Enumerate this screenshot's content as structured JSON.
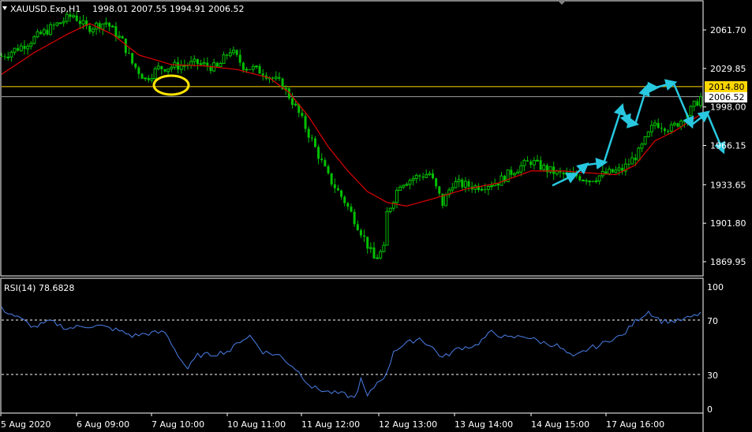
{
  "header": {
    "symbol": "XAUUSD.Exp,H1",
    "ohlc": "1998.01 2007.55 1994.91 2006.52"
  },
  "colors": {
    "background": "#000000",
    "frame": "#ffffff",
    "bull": "#00c000",
    "bear": "#00c000",
    "ma": "#e00000",
    "level_line": "#ffd700",
    "price_line": "#a0a0a0",
    "arrows": "#28c8e0",
    "rsi_line": "#4a7fe8",
    "highlight_circle": "#ffe600"
  },
  "price_axis": {
    "ticks": [
      "2061.70",
      "2029.85",
      "1998.00",
      "1966.15",
      "1933.65",
      "1901.80",
      "1869.95"
    ],
    "level_label": "2014.80",
    "last_price_label": "2006.52"
  },
  "rsi_panel": {
    "label": "RSI(14) 78.6828",
    "ticks": [
      "100",
      "70",
      "30",
      "0"
    ]
  },
  "time_axis": {
    "labels": [
      "5 Aug 2020",
      "6 Aug 09:00",
      "7 Aug 10:00",
      "10 Aug 11:00",
      "11 Aug 12:00",
      "12 Aug 13:00",
      "13 Aug 14:00",
      "14 Aug 15:00",
      "17 Aug 16:00"
    ]
  },
  "chart_data": {
    "type": "candlestick",
    "symbol": "XAUUSD.Exp",
    "timeframe": "H1",
    "ylim": [
      1855,
      2080
    ],
    "level_line": 2014.8,
    "last_price": 2006.52,
    "rsi_value": 78.6828,
    "rsi_ylim": [
      0,
      100
    ],
    "rsi_levels": [
      70,
      30
    ],
    "x_labels": [
      "5 Aug 2020",
      "6 Aug 09:00",
      "7 Aug 10:00",
      "10 Aug 11:00",
      "11 Aug 12:00",
      "12 Aug 13:00",
      "13 Aug 14:00",
      "14 Aug 15:00",
      "17 Aug 16:00"
    ],
    "price_path": [
      [
        0,
        2040
      ],
      [
        6,
        2048
      ],
      [
        12,
        2058
      ],
      [
        18,
        2068
      ],
      [
        22,
        2074
      ],
      [
        26,
        2063
      ],
      [
        32,
        2068
      ],
      [
        37,
        2052
      ],
      [
        40,
        2034
      ],
      [
        44,
        2021
      ],
      [
        48,
        2030
      ],
      [
        54,
        2032
      ],
      [
        60,
        2034
      ],
      [
        66,
        2030
      ],
      [
        70,
        2045
      ],
      [
        74,
        2032
      ],
      [
        80,
        2027
      ],
      [
        86,
        2016
      ],
      [
        90,
        1998
      ],
      [
        95,
        1970
      ],
      [
        100,
        1940
      ],
      [
        105,
        1920
      ],
      [
        110,
        1895
      ],
      [
        114,
        1872
      ],
      [
        117,
        1880
      ],
      [
        118,
        1910
      ],
      [
        122,
        1935
      ],
      [
        127,
        1940
      ],
      [
        131,
        1943
      ],
      [
        135,
        1918
      ],
      [
        138,
        1935
      ],
      [
        145,
        1932
      ],
      [
        152,
        1936
      ],
      [
        157,
        1946
      ],
      [
        162,
        1953
      ],
      [
        167,
        1946
      ],
      [
        171,
        1942
      ],
      [
        176,
        1941
      ],
      [
        180,
        1938
      ],
      [
        184,
        1942
      ],
      [
        190,
        1946
      ],
      [
        195,
        1960
      ],
      [
        200,
        1985
      ],
      [
        205,
        1980
      ],
      [
        210,
        1992
      ],
      [
        214,
        2006
      ]
    ],
    "ma_path": [
      [
        0,
        2025
      ],
      [
        10,
        2043
      ],
      [
        20,
        2058
      ],
      [
        27,
        2067
      ],
      [
        34,
        2058
      ],
      [
        42,
        2041
      ],
      [
        52,
        2033
      ],
      [
        62,
        2032
      ],
      [
        72,
        2029
      ],
      [
        82,
        2022
      ],
      [
        88,
        2010
      ],
      [
        94,
        1990
      ],
      [
        100,
        1965
      ],
      [
        106,
        1945
      ],
      [
        112,
        1928
      ],
      [
        118,
        1919
      ],
      [
        124,
        1916
      ],
      [
        132,
        1922
      ],
      [
        142,
        1930
      ],
      [
        152,
        1935
      ],
      [
        162,
        1945
      ],
      [
        172,
        1945
      ],
      [
        182,
        1943
      ],
      [
        188,
        1942
      ],
      [
        194,
        1950
      ],
      [
        200,
        1970
      ],
      [
        206,
        1978
      ],
      [
        214,
        1992
      ]
    ],
    "rsi_path": [
      [
        0,
        82
      ],
      [
        5,
        75
      ],
      [
        10,
        67
      ],
      [
        15,
        72
      ],
      [
        20,
        66
      ],
      [
        25,
        68
      ],
      [
        30,
        68
      ],
      [
        35,
        65
      ],
      [
        40,
        60
      ],
      [
        45,
        62
      ],
      [
        50,
        63
      ],
      [
        55,
        40
      ],
      [
        57,
        33
      ],
      [
        60,
        44
      ],
      [
        65,
        45
      ],
      [
        70,
        48
      ],
      [
        73,
        56
      ],
      [
        76,
        60
      ],
      [
        80,
        47
      ],
      [
        85,
        44
      ],
      [
        90,
        33
      ],
      [
        95,
        18
      ],
      [
        100,
        14
      ],
      [
        105,
        12
      ],
      [
        108,
        9
      ],
      [
        110,
        24
      ],
      [
        112,
        10
      ],
      [
        115,
        22
      ],
      [
        118,
        29
      ],
      [
        120,
        48
      ],
      [
        125,
        55
      ],
      [
        128,
        58
      ],
      [
        132,
        50
      ],
      [
        135,
        42
      ],
      [
        140,
        50
      ],
      [
        145,
        52
      ],
      [
        150,
        63
      ],
      [
        155,
        58
      ],
      [
        160,
        60
      ],
      [
        165,
        55
      ],
      [
        170,
        52
      ],
      [
        175,
        42
      ],
      [
        180,
        50
      ],
      [
        183,
        52
      ],
      [
        187,
        58
      ],
      [
        190,
        60
      ],
      [
        194,
        72
      ],
      [
        198,
        80
      ],
      [
        202,
        72
      ],
      [
        207,
        72
      ],
      [
        212,
        76
      ],
      [
        214,
        79
      ]
    ],
    "forecast_arrows": [
      [
        [
          2006,
          1933
        ],
        [
          2016,
          1942
        ]
      ],
      [
        [
          2016,
          1942
        ],
        [
          2021,
          1950
        ]
      ],
      [
        [
          2021,
          1950
        ],
        [
          2029,
          1952
        ]
      ],
      [
        [
          2029,
          1952
        ],
        [
          2037,
          1998
        ]
      ],
      [
        [
          2037,
          1998
        ],
        [
          2040,
          1985
        ]
      ],
      [
        [
          2040,
          1985
        ],
        [
          2043,
          1984
        ]
      ],
      [
        [
          2043,
          1984
        ],
        [
          2048,
          2014
        ]
      ],
      [
        [
          2048,
          2014
        ],
        [
          2052,
          2014
        ]
      ],
      [
        [
          2052,
          2014
        ],
        [
          2060,
          2018
        ]
      ],
      [
        [
          2060,
          2018
        ],
        [
          2068,
          1983
        ]
      ],
      [
        [
          2068,
          1983
        ],
        [
          2075,
          1993
        ]
      ],
      [
        [
          2075,
          1993
        ],
        [
          2082,
          1962
        ]
      ]
    ],
    "circle_price": 2019
  }
}
